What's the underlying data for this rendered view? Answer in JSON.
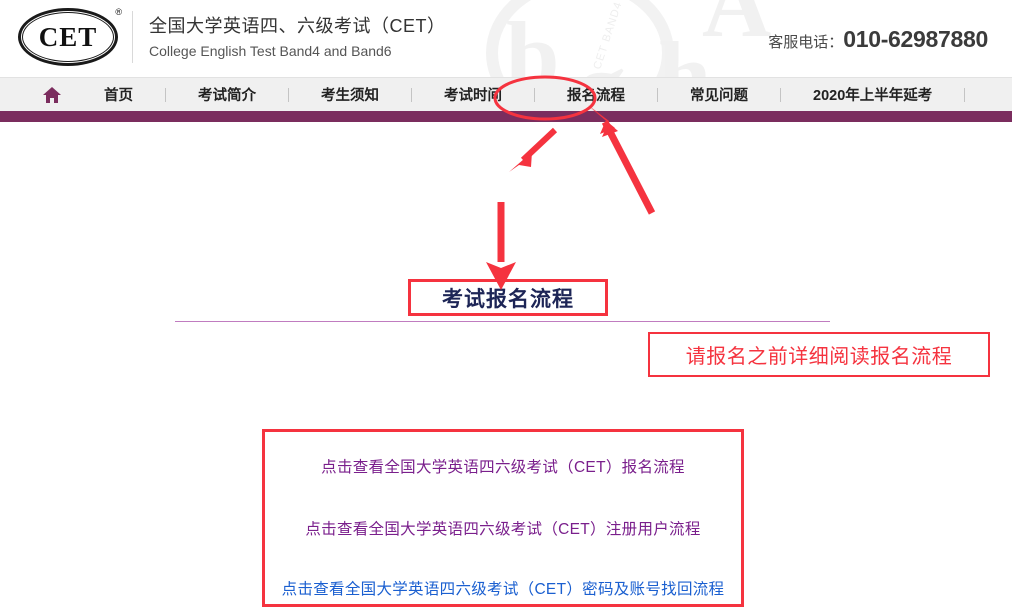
{
  "header": {
    "logo_text": "CET",
    "logo_reg_mark": "®",
    "title_cn": "全国大学英语四、六级考试（CET）",
    "title_en": "College English Test Band4 and Band6",
    "hotline_label": "客服电话：",
    "hotline_number": "010-62987880",
    "watermark_letters": "CET"
  },
  "nav": {
    "home_icon": "home-icon",
    "items": [
      {
        "label": "首页",
        "active": false
      },
      {
        "label": "考试简介",
        "active": false
      },
      {
        "label": "考生须知",
        "active": false
      },
      {
        "label": "考试时间",
        "active": false
      },
      {
        "label": "报名流程",
        "active": true
      },
      {
        "label": "常见问题",
        "active": false
      },
      {
        "label": "2020年上半年延考",
        "active": false
      }
    ]
  },
  "main": {
    "page_title": "考试报名流程",
    "note": "请报名之前详细阅读报名流程",
    "links": [
      {
        "text": "点击查看全国大学英语四六级考试（CET）报名流程",
        "color": "#7a1f8c"
      },
      {
        "text": "点击查看全国大学英语四六级考试（CET）注册用户流程",
        "color": "#7a1f8c"
      },
      {
        "text": "点击查看全国大学英语四六级考试（CET）密码及账号找回流程",
        "color": "#1a5fd0"
      }
    ]
  },
  "colors": {
    "annotation_red": "#f5333f",
    "nav_bar_purple": "#7b2d5e",
    "nav_background": "#f0f0f0",
    "title_navy": "#1d2556",
    "divider_purple": "#c07cc0"
  },
  "annotations": {
    "ellipse_target": "报名流程",
    "arrow_to_nav": "arrow-pointing-to-nav-item",
    "arrow_to_title": "arrow-pointing-to-page-title",
    "arrow_to_links": "arrow-pointing-down-to-links-box"
  }
}
